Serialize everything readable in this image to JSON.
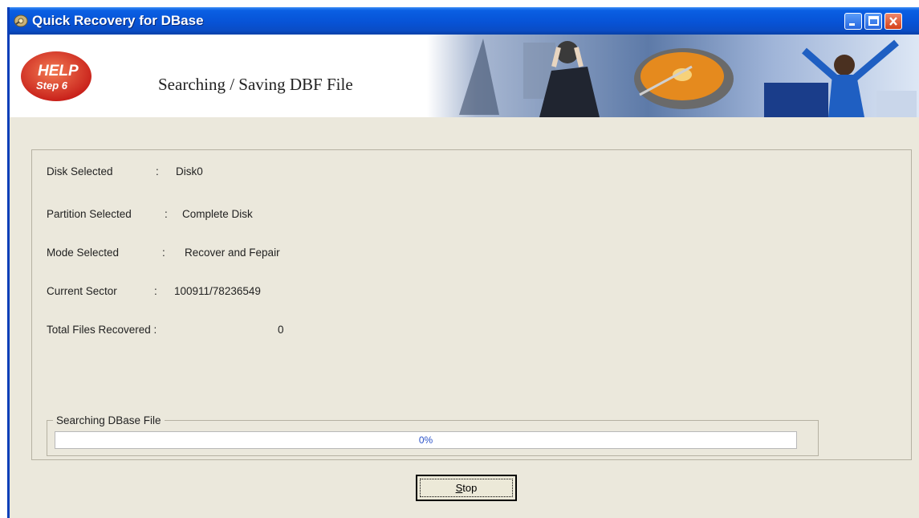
{
  "window": {
    "title": "Quick Recovery for DBase"
  },
  "banner": {
    "help_text": "HELP",
    "step_text": "Step 6",
    "heading": "Searching / Saving DBF File"
  },
  "info": {
    "disk_label": "Disk Selected",
    "disk_sep": ":",
    "disk_value": "Disk0",
    "partition_label": "Partition Selected",
    "partition_sep": ":",
    "partition_value": "Complete Disk",
    "mode_label": "Mode Selected",
    "mode_sep": ":",
    "mode_value": "Recover and Fepair",
    "sector_label": "Current Sector",
    "sector_sep": ":",
    "sector_value": "100911/78236549",
    "files_label": "Total Files Recovered :",
    "files_value": "0"
  },
  "search": {
    "legend": "Searching DBase File",
    "progress_text": "0%",
    "progress_percent": 0
  },
  "buttons": {
    "stop_accel": "S",
    "stop_rest": "top"
  },
  "colors": {
    "titlebar": "#0a5fe3",
    "window_bg": "#ebe8dc",
    "progress_text": "#2a52c8",
    "help_red": "#c8201a"
  },
  "icons": {
    "app": "app-icon",
    "minimize": "minimize-icon",
    "maximize": "maximize-icon",
    "close": "close-icon"
  }
}
